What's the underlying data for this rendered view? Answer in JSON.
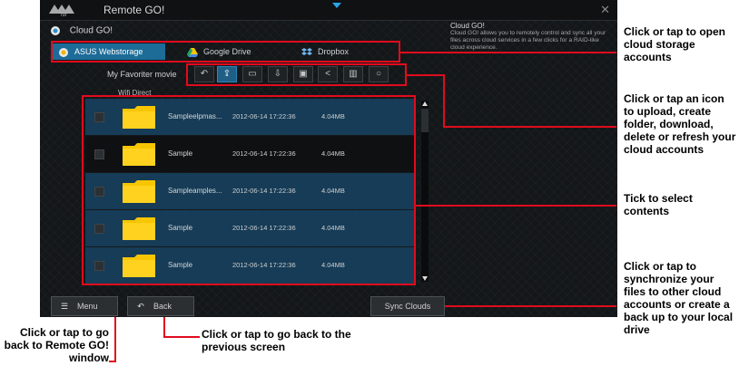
{
  "app": {
    "title": "Remote GO!",
    "section_title": "Cloud GO!",
    "tabs": [
      {
        "label": "ASUS Webstorage",
        "active": true,
        "icon": "asus-webstorage-icon"
      },
      {
        "label": "Google Drive",
        "active": false,
        "icon": "google-drive-icon"
      },
      {
        "label": "Dropbox",
        "active": false,
        "icon": "dropbox-icon"
      }
    ],
    "info_panel": {
      "title": "Cloud GO!",
      "text": "Cloud GO! allows you to remotely control and sync all your files across cloud services in a few clicks for a RAID-like cloud experience."
    },
    "current_folder": "My Favoriter movie",
    "path": "Wifi Direct",
    "toolbar_icons": [
      "back-icon",
      "upload-icon",
      "new-folder-icon",
      "download-icon",
      "move-icon",
      "share-icon",
      "delete-icon",
      "refresh-icon"
    ],
    "files": [
      {
        "name": "Sampleelpmas...",
        "date": "2012-06-14 17:22:36",
        "size": "4.04MB"
      },
      {
        "name": "Sample",
        "date": "2012-06-14 17:22:36",
        "size": "4.04MB"
      },
      {
        "name": "Sampleamples...",
        "date": "2012-06-14 17:22:36",
        "size": "4.04MB"
      },
      {
        "name": "Sample",
        "date": "2012-06-14 17:22:36",
        "size": "4.04MB"
      },
      {
        "name": "Sample",
        "date": "2012-06-14 17:22:36",
        "size": "4.04MB"
      }
    ],
    "buttons": {
      "menu": "Menu",
      "back": "Back",
      "sync": "Sync Clouds"
    }
  },
  "annotations": {
    "open_cloud": "Click or tap to open cloud storage accounts",
    "toolbar": "Click or tap an icon to upload, create folder, download, delete or refresh your cloud accounts",
    "select": "Tick to select contents",
    "sync": "Click or tap to synchronize your files to other cloud accounts or create a back up to your local drive",
    "menu": "Click or tap to go back to Remote GO! window",
    "back": "Click or tap to go back to the previous screen"
  },
  "colors": {
    "highlight": "#e10b1d",
    "accent": "#1d6c98",
    "folder": "#f7c600"
  }
}
